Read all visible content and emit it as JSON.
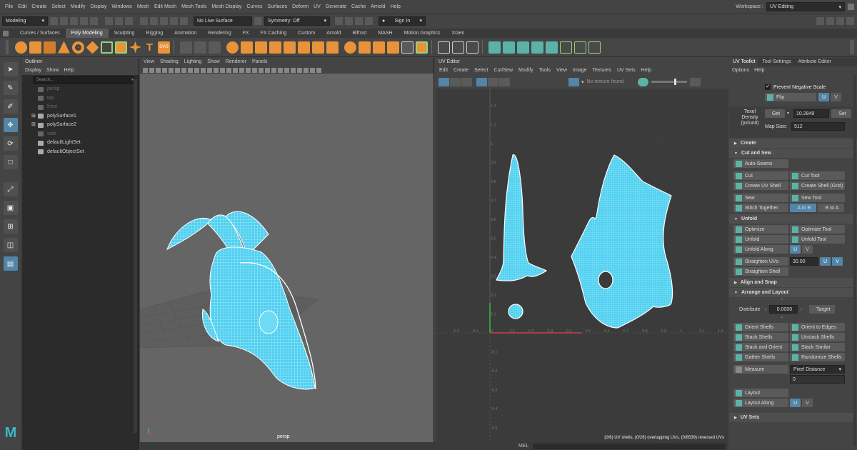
{
  "menubar": {
    "items": [
      "File",
      "Edit",
      "Create",
      "Select",
      "Modify",
      "Display",
      "Windows",
      "Mesh",
      "Edit Mesh",
      "Mesh Tools",
      "Mesh Display",
      "Curves",
      "Surfaces",
      "Deform",
      "UV",
      "Generate",
      "Cache",
      "Arnold",
      "Help"
    ],
    "workspace_label": "Workspace :",
    "workspace_value": "UV Editing"
  },
  "statusline": {
    "mode": "Modeling",
    "live_surface": "No Live Surface",
    "symmetry": "Symmetry: Off",
    "signin": "Sign In"
  },
  "shelf": {
    "tabs": [
      "Curves / Surfaces",
      "Poly Modeling",
      "Sculpting",
      "Rigging",
      "Animation",
      "Rendering",
      "FX",
      "FX Caching",
      "Custom",
      "Arnold",
      "Bifrost",
      "MASH",
      "Motion Graphics",
      "XGen"
    ],
    "active_tab": "Poly Modeling",
    "text_icon": "T",
    "svg_icon": "SVG"
  },
  "outliner": {
    "title": "Outliner",
    "menu": [
      "Display",
      "Show",
      "Help"
    ],
    "search_placeholder": "Search...",
    "items": [
      {
        "name": "persp",
        "dim": true
      },
      {
        "name": "top",
        "dim": true
      },
      {
        "name": "front",
        "dim": true
      },
      {
        "name": "polySurface1",
        "dim": false
      },
      {
        "name": "polySurface2",
        "dim": false
      },
      {
        "name": "side",
        "dim": true
      },
      {
        "name": "defaultLightSet",
        "dim": false
      },
      {
        "name": "defaultObjectSet",
        "dim": false
      }
    ]
  },
  "viewport": {
    "menu": [
      "View",
      "Shading",
      "Lighting",
      "Show",
      "Renderer",
      "Panels"
    ],
    "camera_label": "persp",
    "mesh_color": "#4fd0f0"
  },
  "uv_editor": {
    "title": "UV Editor",
    "menu": [
      "Edit",
      "Create",
      "Select",
      "Cut/Sew",
      "Modify",
      "Tools",
      "View",
      "Image",
      "Textures",
      "UV Sets",
      "Help"
    ],
    "texture_label": "No texture found",
    "status": "(0/6) UV shells, (0/28) overlapping UVs, (0/8539) reversed UVs",
    "x_ticks": [
      "-0.2",
      "-0.1",
      "0",
      "0.1",
      "0.2",
      "0.3",
      "0.4",
      "0.5",
      "0.6",
      "0.7",
      "0.8",
      "0.9",
      "1",
      "1.1",
      "1.2"
    ],
    "y_ticks": [
      "1.2",
      "1.1",
      "1",
      "0.9",
      "0.8",
      "0.7",
      "0.6",
      "0.5",
      "0.4",
      "0.3",
      "0.2",
      "0.1",
      "-0.1",
      "-0.2",
      "-0.3",
      "-0.4",
      "-0.5",
      "-0.6"
    ]
  },
  "uv_toolkit": {
    "tabs": [
      "UV Toolkit",
      "Tool Settings",
      "Attribute Editor"
    ],
    "menu": [
      "Options",
      "Help"
    ],
    "prevent_negative_scale": "Prevent Negative Scale",
    "flip": "Flip",
    "u": "U",
    "v": "V",
    "texel_density_label": "Texel Density (px/unit)",
    "get": "Get",
    "texel_value": "10.2849",
    "set": "Set",
    "map_size_label": "Map Size:",
    "map_size_value": "512",
    "create_section": "Create",
    "cut_sew_section": "Cut and Sew",
    "auto_seams": "Auto-Seams",
    "cut": "Cut",
    "cut_tool": "Cut Tool",
    "create_uv_shell": "Create UV Shell",
    "create_shell_grid": "Create Shell (Grid)",
    "sew": "Sew",
    "sew_tool": "Sew Tool",
    "stitch_together": "Stitch Together",
    "a_to_b": "A to B",
    "b_to_a": "B to A",
    "unfold_section": "Unfold",
    "optimize": "Optimize",
    "optimize_tool": "Optimize Tool",
    "unfold": "Unfold",
    "unfold_tool": "Unfold Tool",
    "unfold_along": "Unfold Along",
    "straighten_uvs": "Straighten UVs",
    "straighten_value": "30.00",
    "straighten_shell": "Straighten Shell",
    "align_section": "Align and Snap",
    "arrange_section": "Arrange and Layout",
    "distribute": "Distribute",
    "distribute_value": "0.0000",
    "target": "Target",
    "orient_shells": "Orient Shells",
    "orient_to_edges": "Orient to Edges",
    "stack_shells": "Stack Shells",
    "unstack_shells": "Unstack Shells",
    "stack_and_orient": "Stack and Orient",
    "stack_similar": "Stack Similar",
    "gather_shells": "Gather Shells",
    "randomize_shells": "Randomize Shells",
    "measure": "Measure",
    "pixel_distance": "Pixel Distance",
    "measure_value": "0",
    "layout": "Layout",
    "layout_along": "Layout Along",
    "uv_sets_section": "UV Sets"
  },
  "bottom": {
    "mel_label": "MEL"
  },
  "colors": {
    "accent": "#5285a6",
    "uv_fill": "#4fd0f0",
    "icon_orange": "#e8923a"
  }
}
